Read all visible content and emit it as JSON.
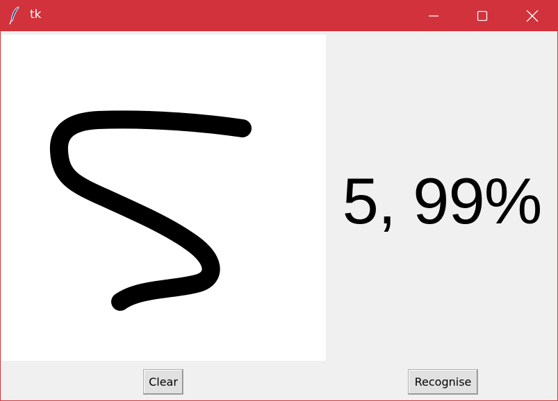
{
  "window": {
    "title": "tk",
    "titlebar_color": "#d1323b",
    "icons": [
      "feather-icon",
      "minimize-icon",
      "maximize-icon",
      "close-icon"
    ]
  },
  "canvas": {
    "background": "#ffffff",
    "stroke_color": "#000000",
    "drawing": "handwritten digit stroke"
  },
  "result": {
    "text": "5, 99%"
  },
  "buttons": {
    "clear_label": "Clear",
    "recognise_label": "Recognise"
  }
}
